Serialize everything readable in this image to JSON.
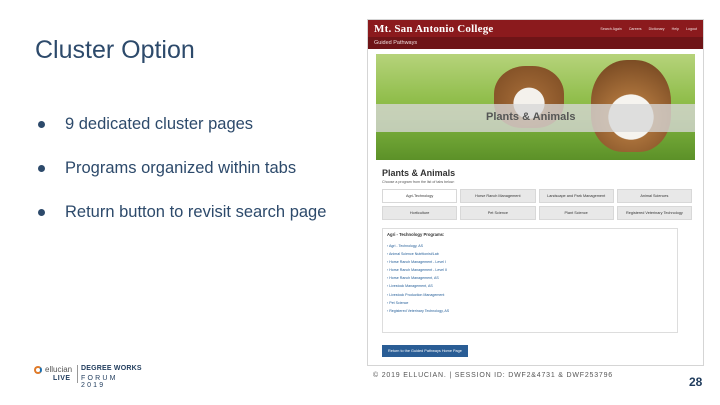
{
  "slide": {
    "title": "Cluster Option",
    "bullets": [
      "9 dedicated cluster pages",
      "Programs organized within tabs",
      "Return button to revisit search page"
    ]
  },
  "screenshot": {
    "brand": "Mt. San Antonio College",
    "toplinks": [
      "Search Again",
      "Careers",
      "Dictionary",
      "Help",
      "Logout"
    ],
    "subnav": "Guided Pathways",
    "hero_title": "Plants & Animals",
    "heading": "Plants & Animals",
    "choose_text": "Choose a program from the list of tabs below:",
    "tabs": [
      "Agri-Technology",
      "Horse Ranch Management",
      "Landscape and Park Management",
      "Animal Sciences",
      "Horticulture",
      "Pet Science",
      "Plant Science",
      "Registered Veterinary Technology"
    ],
    "programs_header": "Agri - Technology Programs:",
    "programs": [
      "Agri - Technology, AS",
      "Animal Science Nutritionist/Lab",
      "Horse Ranch Management - Level I",
      "Horse Ranch Management - Level II",
      "Horse Ranch Management, AS",
      "Livestock Management, AS",
      "Livestock Production Management",
      "Pet Science",
      "Registered Veterinary Technology, AS"
    ],
    "return_button": "Return to the Guided Pathways Home Page"
  },
  "footer": {
    "logo_ellucian": "ellucian",
    "logo_live": "LIVE",
    "logo_degreeworks": "DEGREE WORKS",
    "logo_forum": "FORUM 2019",
    "copyright": "© 2019 ELLUCIAN. | SESSION ID: DWF2&4731 & DWF253796",
    "page_number": "28"
  },
  "colors": {
    "title_color": "#2d4a6b",
    "college_red": "#8b1a1d",
    "return_blue": "#2a5d95"
  }
}
